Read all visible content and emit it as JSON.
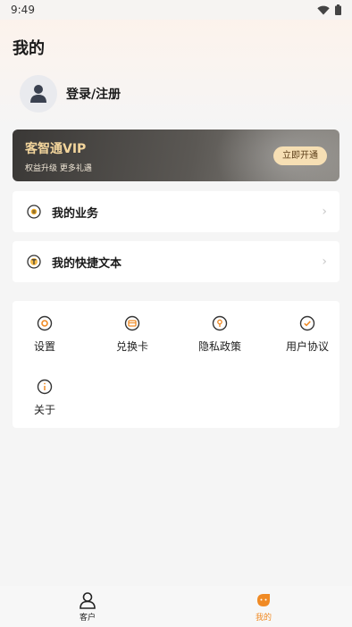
{
  "status_bar": {
    "time": "9:49"
  },
  "page": {
    "title": "我的"
  },
  "user": {
    "login_label": "登录/注册"
  },
  "vip": {
    "title": "客智通VIP",
    "subtitle": "权益升级 更多礼遇",
    "button_label": "立即开通",
    "colors": {
      "title": "#f3d59c",
      "button_bg": "#f6dfb4"
    }
  },
  "menu": [
    {
      "label": "我的业务",
      "icon": "business-icon"
    },
    {
      "label": "我的快捷文本",
      "icon": "text-icon"
    }
  ],
  "grid": [
    {
      "label": "设置",
      "icon": "settings-icon"
    },
    {
      "label": "兑换卡",
      "icon": "card-icon"
    },
    {
      "label": "隐私政策",
      "icon": "privacy-icon"
    },
    {
      "label": "用户协议",
      "icon": "agreement-icon"
    },
    {
      "label": "关于",
      "icon": "info-icon"
    }
  ],
  "tabs": [
    {
      "label": "客户",
      "icon": "customer-icon",
      "active": false
    },
    {
      "label": "我的",
      "icon": "mine-icon",
      "active": true
    }
  ],
  "colors": {
    "accent": "#f08a24",
    "text": "#1a1a1a",
    "background": "#f5f5f5"
  }
}
